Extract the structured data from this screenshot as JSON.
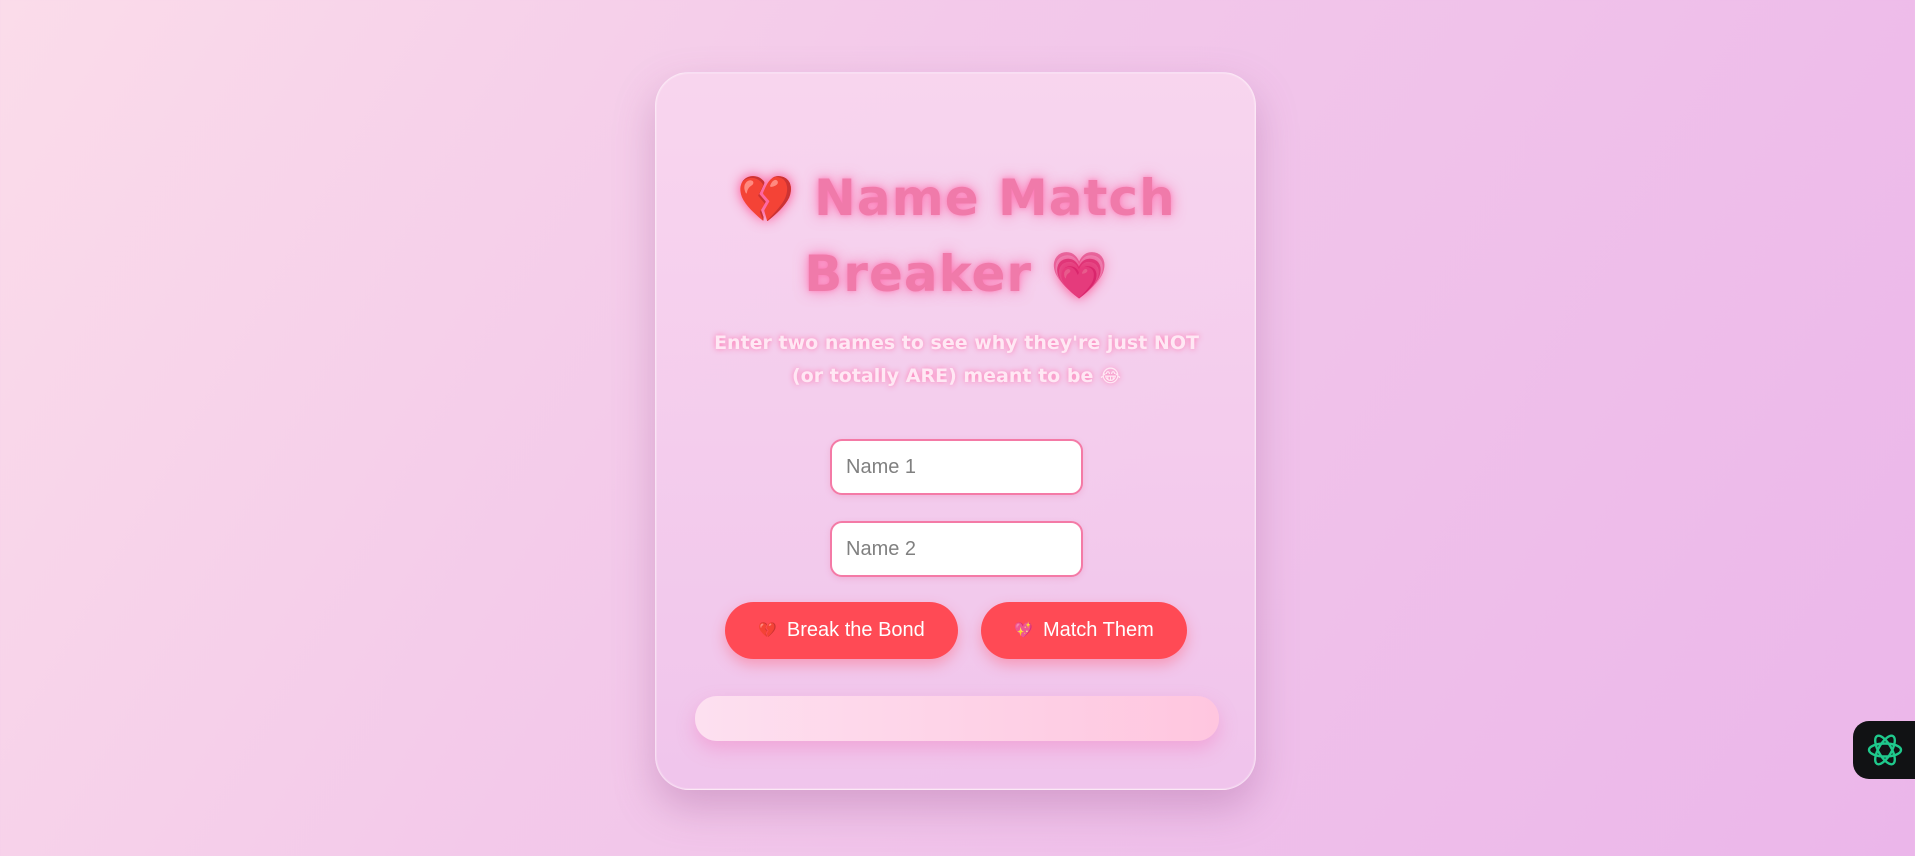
{
  "title": {
    "left_emoji": "💔",
    "line1": "Name Match",
    "line2": "Breaker",
    "right_emoji": "💗"
  },
  "subtitle": {
    "line1": "Enter two names to see why they're just NOT",
    "line2": "(or totally ARE) meant to be",
    "emoji": "😂"
  },
  "inputs": {
    "name1_placeholder": "Name 1",
    "name1_value": "",
    "name2_placeholder": "Name 2",
    "name2_value": ""
  },
  "buttons": {
    "break": {
      "icon": "💔",
      "label": "Break the Bond"
    },
    "match": {
      "icon": "💖",
      "label": "Match Them"
    }
  },
  "result": {
    "text": ""
  },
  "widget": {
    "icon": "ai-assistant-icon"
  },
  "colors": {
    "accent": "#ff4a55",
    "title_pink": "#f07aaa",
    "input_border": "#f47aa6",
    "widget_bg": "#111214",
    "widget_icon": "#1fc98c"
  }
}
